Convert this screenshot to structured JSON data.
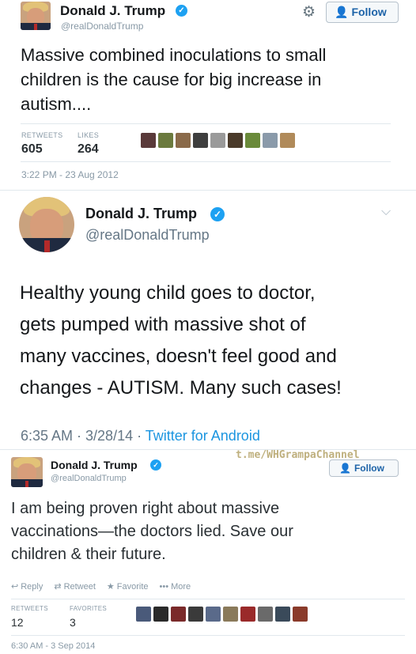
{
  "tweet1": {
    "name": "Donald J. Trump",
    "handle": "@realDonaldTrump",
    "follow_label": "Follow",
    "text": "Massive combined inoculations to small\nchildren is the cause for big increase in\nautism....",
    "retweets_label": "RETWEETS",
    "likes_label": "LIKES",
    "retweets": "605",
    "likes": "264",
    "timestamp": "3:22 PM - 23 Aug 2012",
    "icons": [
      "settings-gear-icon",
      "follow-person-plus-icon",
      "verified-badge-icon"
    ],
    "thumb_colors": [
      "#5a3a3a",
      "#6b7a3e",
      "#8a6a4a",
      "#3e3e3e",
      "#9a9a9a",
      "#4a3a2a",
      "#6a8a3a",
      "#8a9aaa",
      "#b08a5a"
    ]
  },
  "tweet2": {
    "name": "Donald J. Trump",
    "handle": "@realDonaldTrump",
    "text": "Healthy young child goes to doctor,\ngets pumped with massive shot of\nmany vaccines, doesn't feel good and\nchanges - AUTISM. Many such cases!",
    "timestamp": "6:35 AM · 3/28/14 · ",
    "source": "Twitter for Android",
    "icons": [
      "verified-badge-icon",
      "chevron-down-icon"
    ]
  },
  "watermark": "t.me/WHGrampaChannel",
  "tweet3": {
    "name": "Donald J. Trump",
    "handle": "@realDonaldTrump",
    "follow_label": "Follow",
    "text": "I am being proven right about massive\nvaccinations—the doctors lied. Save our\nchildren & their future.",
    "reply_label": "Reply",
    "retweet_label": "Retweet",
    "favorite_label": "Favorite",
    "more_label": "More",
    "retweets_label": "RETWEETS",
    "favorites_label": "FAVORITES",
    "retweets": "12",
    "favorites": "3",
    "timestamp": "6:30 AM - 3 Sep 2014",
    "icons": [
      "reply-arrow-icon",
      "retweet-icon",
      "favorite-star-icon",
      "more-dots-icon",
      "verified-badge-icon",
      "follow-person-plus-icon"
    ],
    "thumb_colors": [
      "#4a5a7a",
      "#2a2a2a",
      "#7a2a2a",
      "#3a3a3a",
      "#5a6a8a",
      "#8a7a5a",
      "#9a2a2a",
      "#6a6a6a",
      "#3a4a5a",
      "#8a3a2a"
    ]
  }
}
